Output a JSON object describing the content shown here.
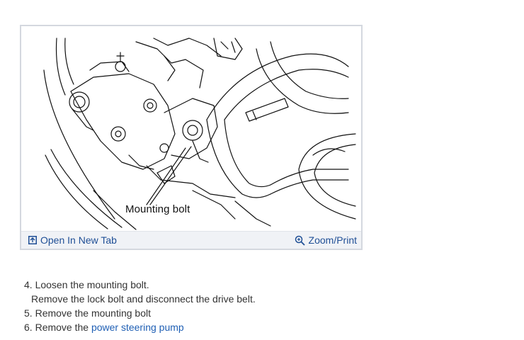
{
  "figure": {
    "caption": "Mounting bolt",
    "open_tab_label": "Open In New Tab",
    "zoom_label": "Zoom/Print",
    "open_tab_icon": "open-new-tab-icon",
    "zoom_icon": "zoom-magnifier-icon"
  },
  "steps": [
    {
      "num": "4.",
      "text": "Loosen the mounting bolt."
    },
    {
      "text": "Remove the lock bolt and disconnect the drive belt."
    },
    {
      "num": "5.",
      "text": "Remove the mounting bolt"
    },
    {
      "num": "6.",
      "prefix": "Remove the",
      "link": "power steering pump"
    }
  ],
  "colors": {
    "link": "#1f5fb4",
    "toolbar_bg": "#f0f2f6",
    "card_border": "#d4d8df"
  }
}
